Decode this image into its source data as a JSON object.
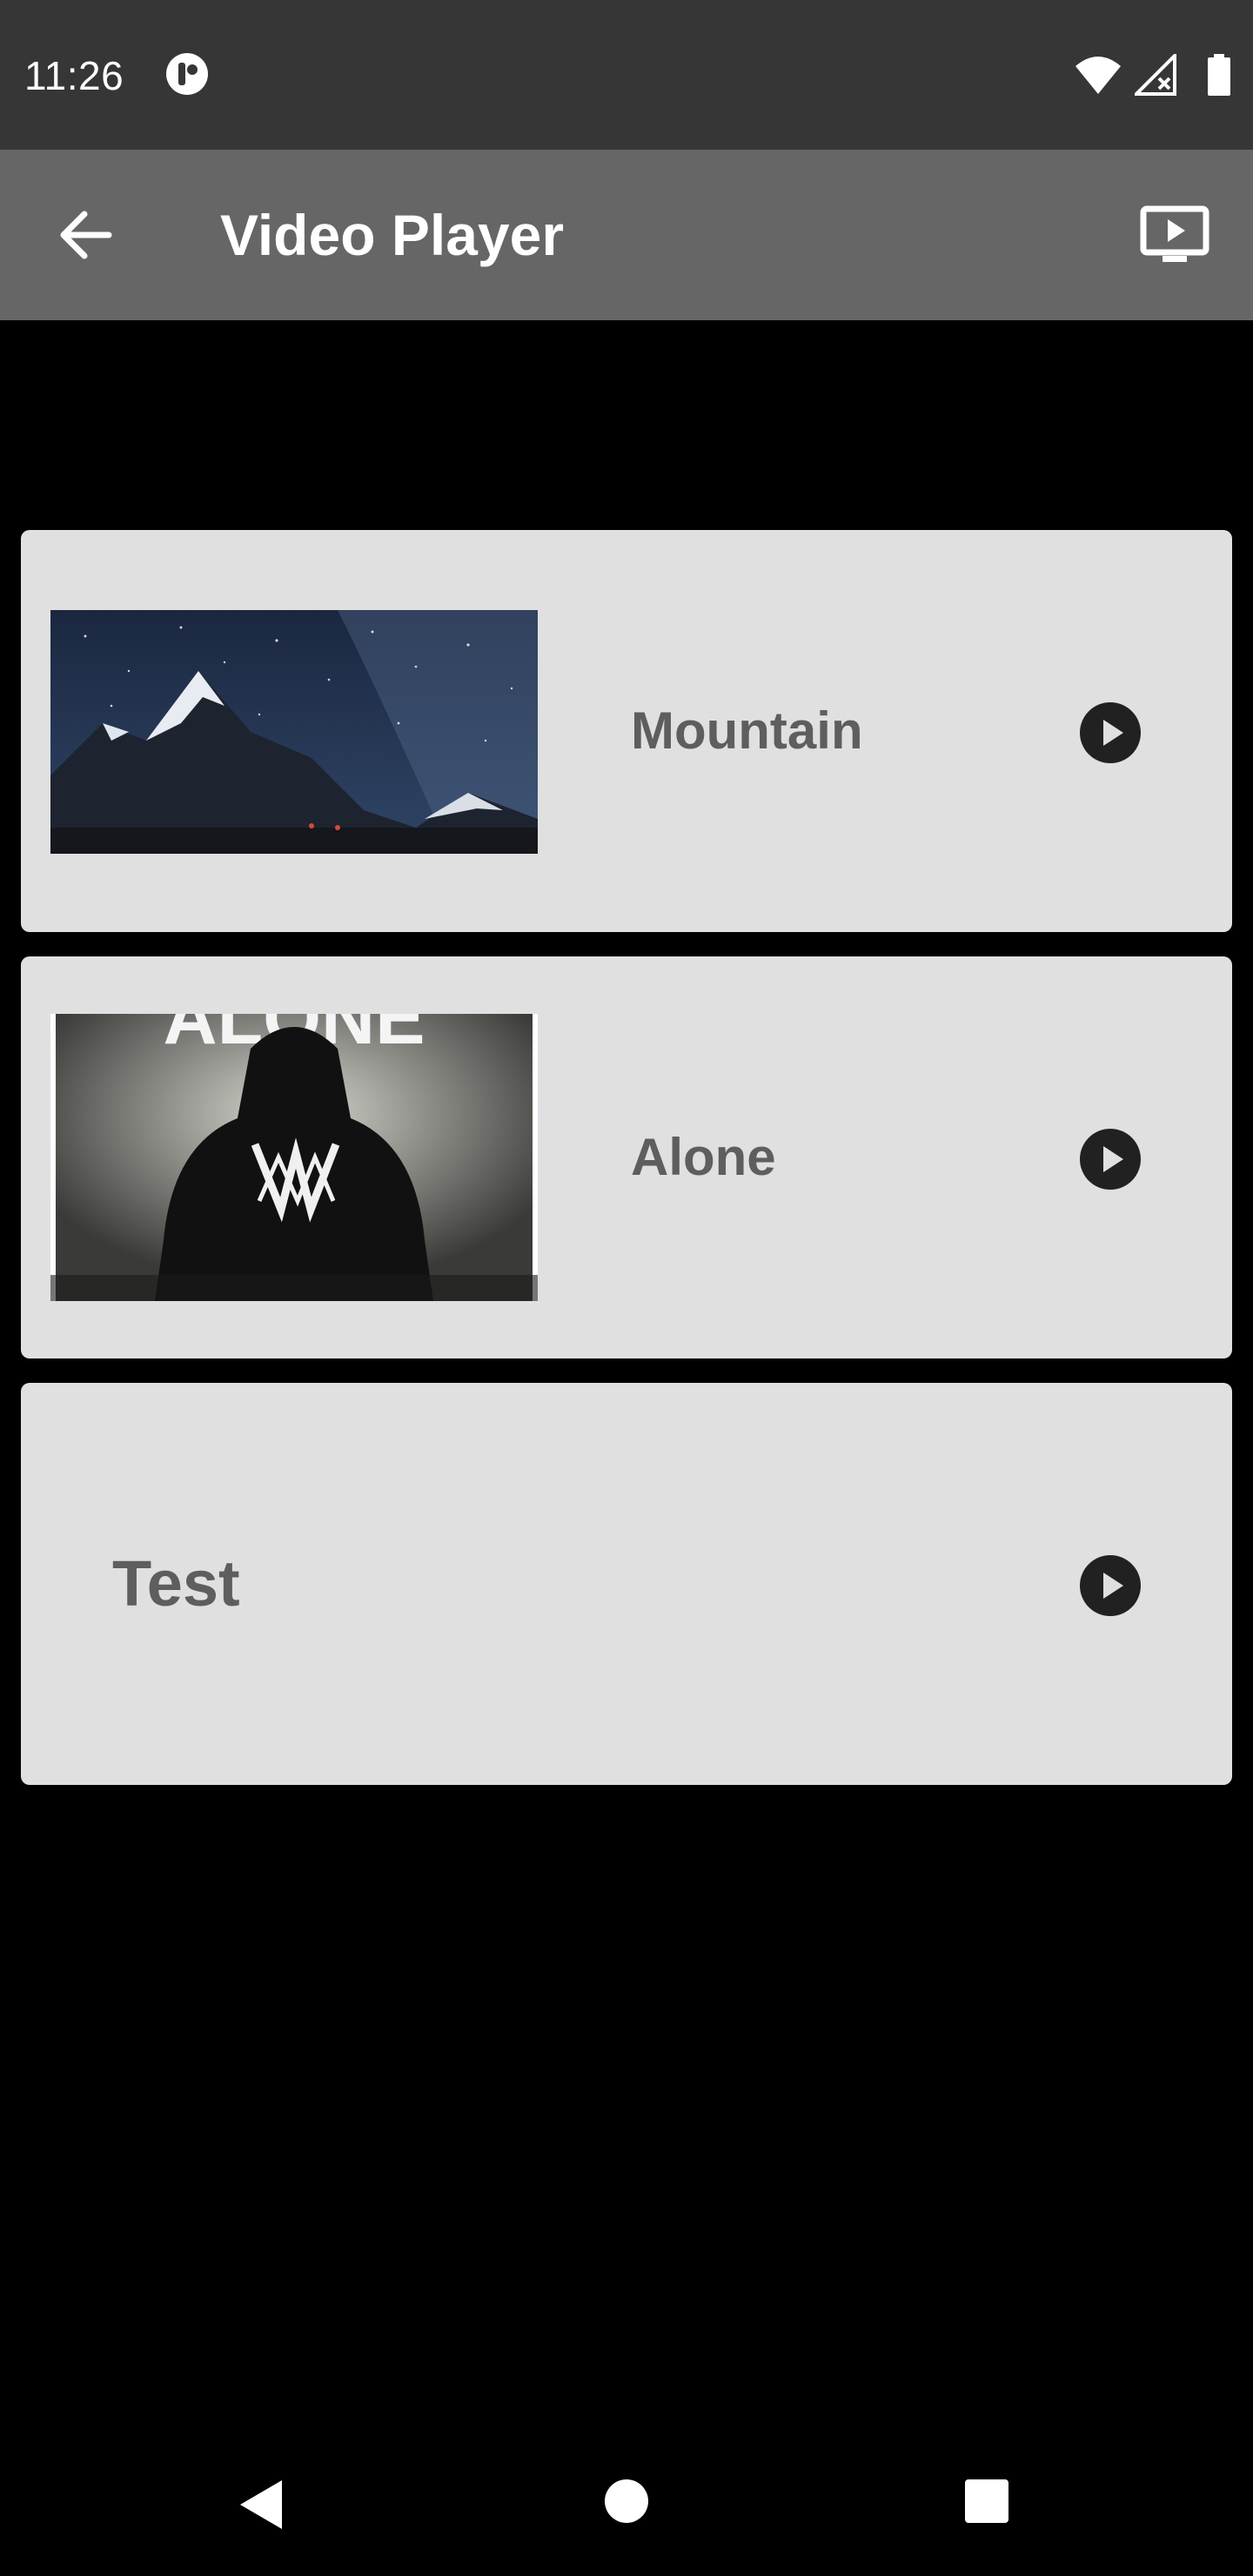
{
  "status_bar": {
    "time": "11:26",
    "icons": [
      "app-notification-icon",
      "wifi-icon",
      "signal-no-data-icon",
      "battery-icon"
    ]
  },
  "app_bar": {
    "title": "Video Player",
    "back_icon": "arrow-back-icon",
    "cast_icon": "cast-screen-icon"
  },
  "videos": [
    {
      "title": "Mountain",
      "thumbnail": "mountain-night-sky-thumbnail",
      "play_icon": "play-circle-icon"
    },
    {
      "title": "Alone",
      "thumbnail": "alone-hooded-figure-thumbnail",
      "thumbnail_text": "ALONE",
      "play_icon": "play-circle-icon"
    },
    {
      "title": "Test",
      "play_icon": "play-circle-icon"
    }
  ],
  "nav_bar": {
    "icons": [
      "nav-back-icon",
      "nav-home-icon",
      "nav-recents-icon"
    ]
  },
  "colors": {
    "status_bar": "#363636",
    "app_bar": "#666666",
    "background": "#000000",
    "card": "#e0e0e0",
    "card_text": "#5e5e5e",
    "play_icon": "#212121"
  }
}
